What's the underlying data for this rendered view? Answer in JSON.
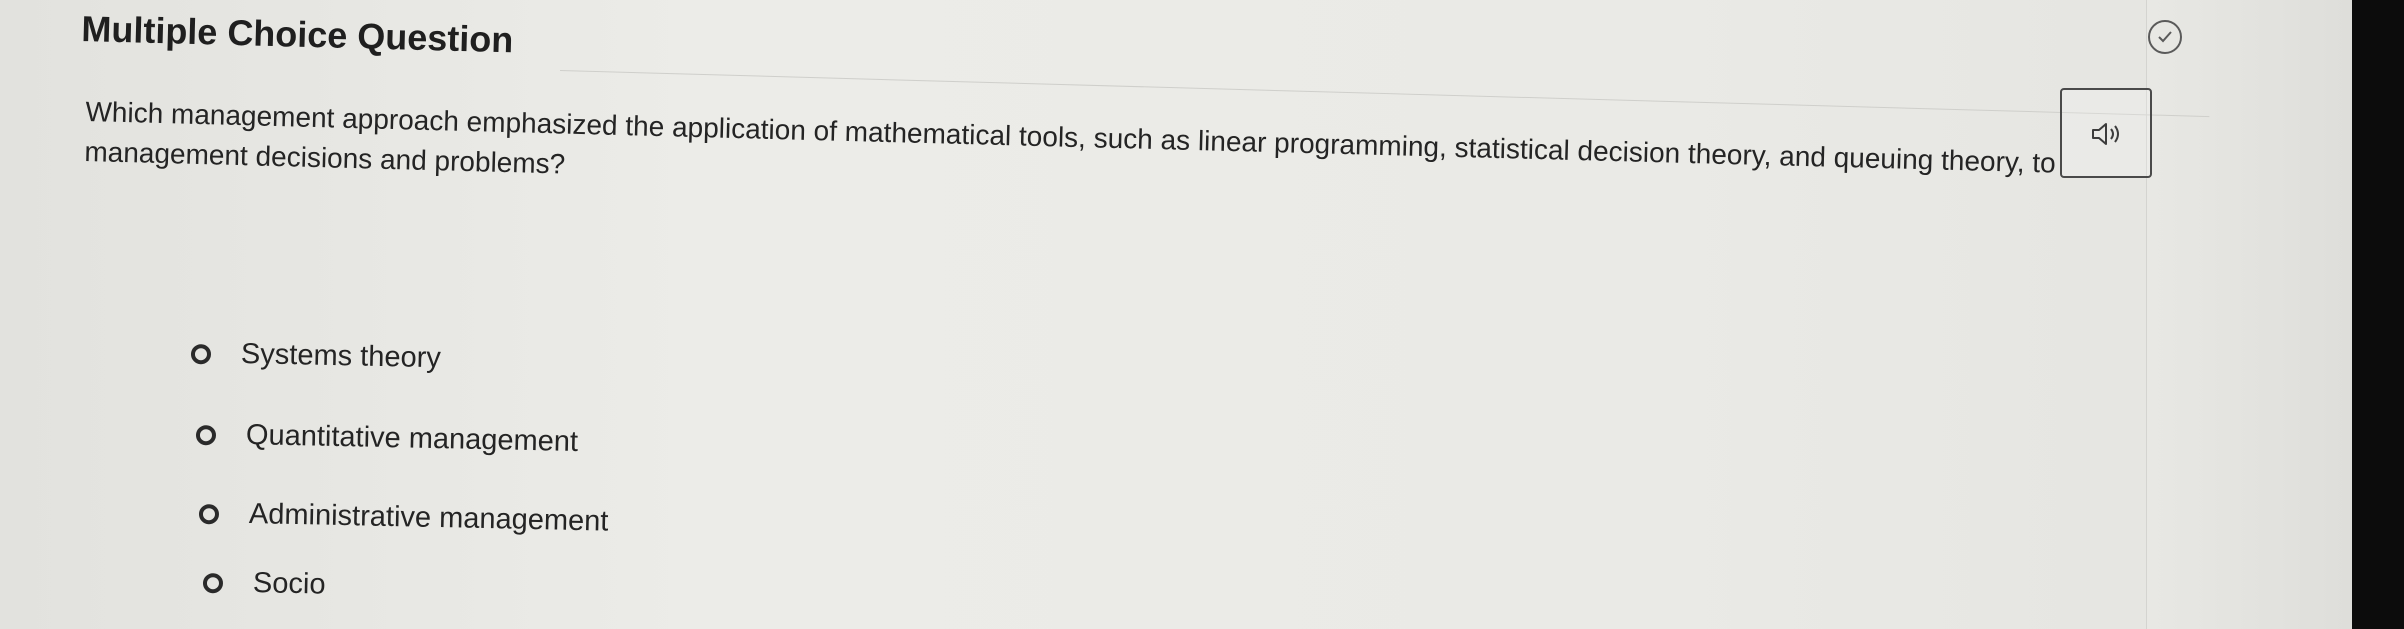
{
  "header": {
    "title": "Multiple Choice Question"
  },
  "question": {
    "text": "Which management approach emphasized the application of mathematical tools, such as linear programming, statistical decision theory, and queuing theory, to management decisions and problems?"
  },
  "options": [
    {
      "label": "Systems theory"
    },
    {
      "label": "Quantitative management"
    },
    {
      "label": "Administrative management"
    },
    {
      "label": "Socio"
    }
  ],
  "icons": {
    "audio": "speaker-icon",
    "status": "check-circle-icon"
  },
  "colors": {
    "page_background": "#eaeae6",
    "text": "#242424",
    "radio_border": "#2a2a2a",
    "bezel": "#0c0c0c"
  }
}
